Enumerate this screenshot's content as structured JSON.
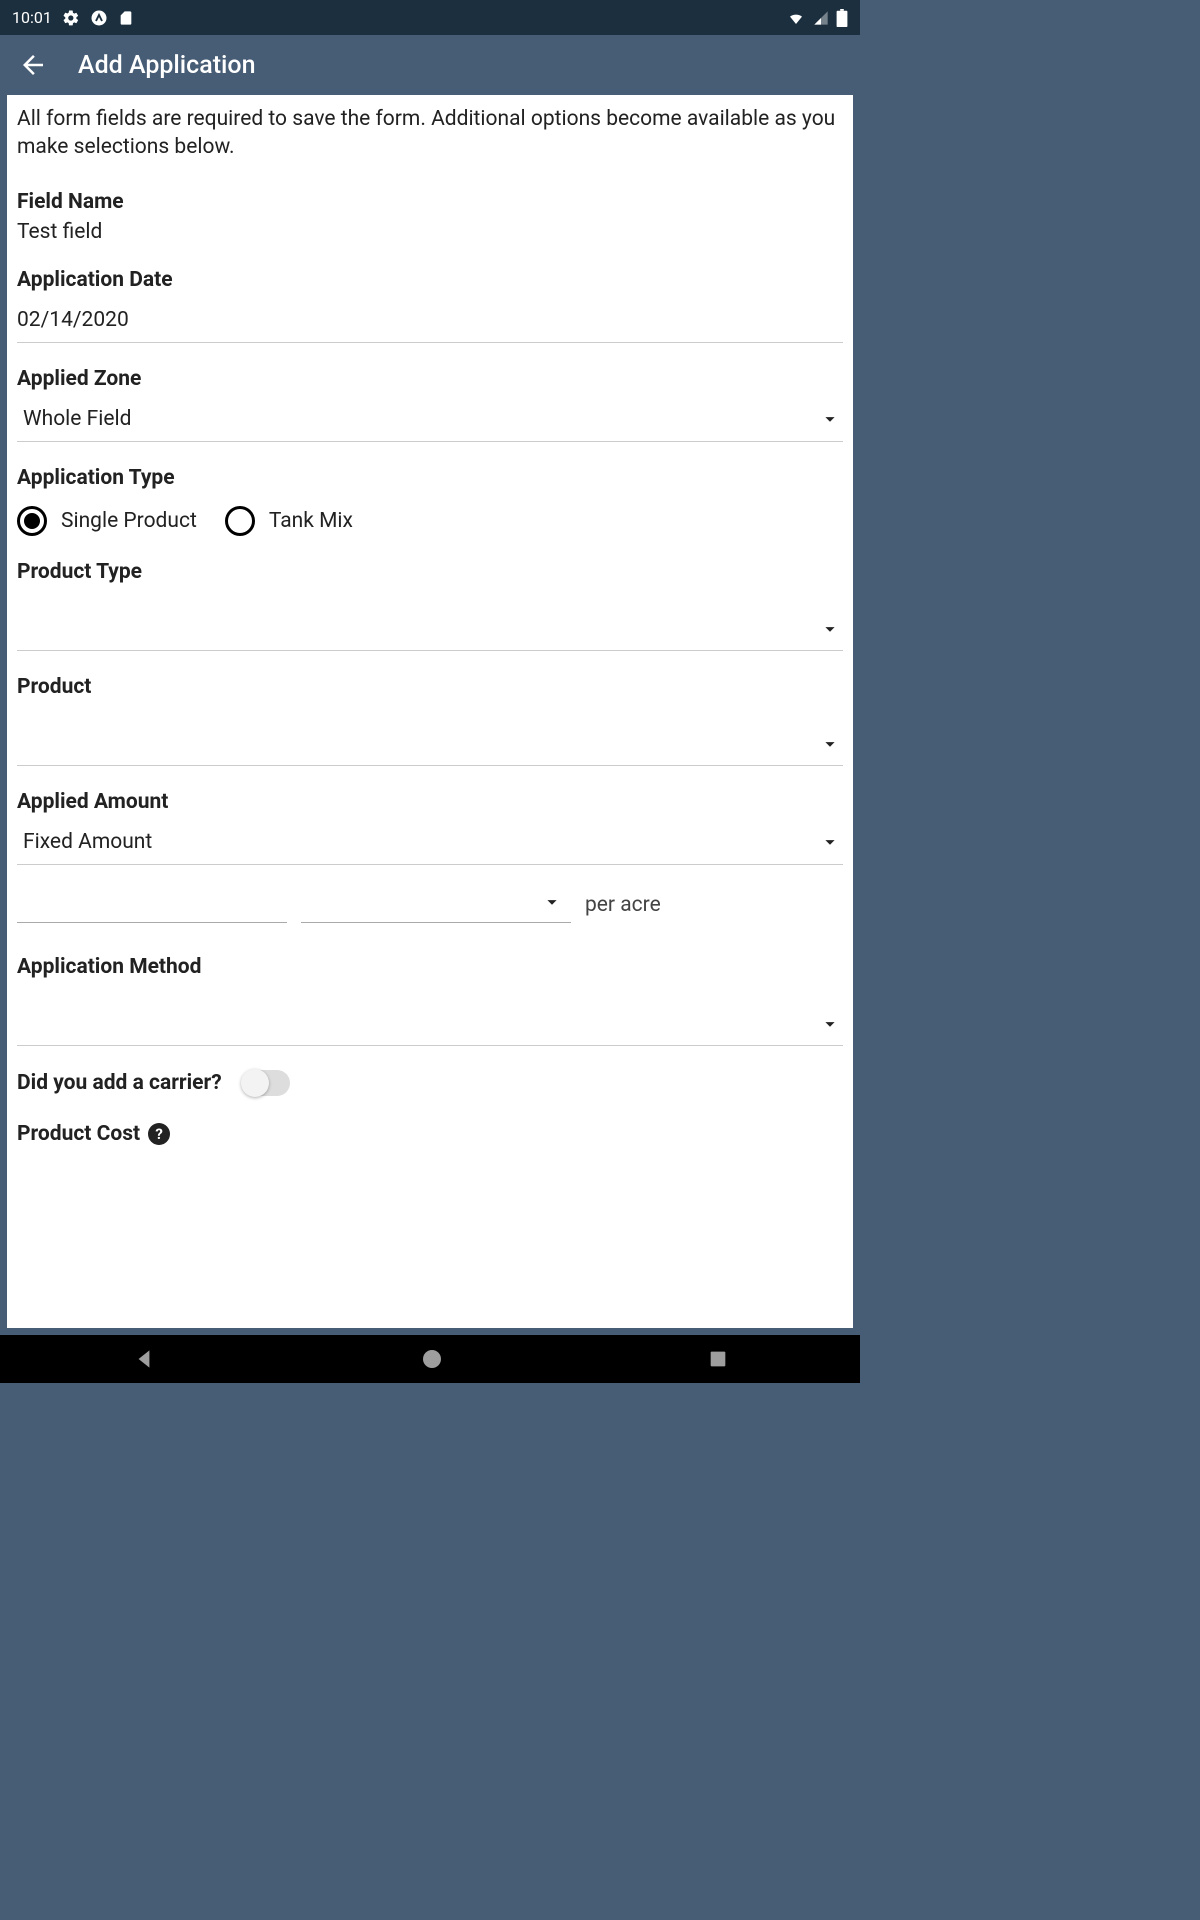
{
  "status": {
    "time": "10:01"
  },
  "header": {
    "title": "Add Application"
  },
  "form": {
    "instructions": "All form fields are required to save the form. Additional options become available as you make selections below.",
    "field_name_label": "Field Name",
    "field_name_value": "Test field",
    "application_date_label": "Application Date",
    "application_date_value": "02/14/2020",
    "applied_zone_label": "Applied Zone",
    "applied_zone_value": "Whole Field",
    "application_type_label": "Application Type",
    "application_type_options": {
      "single": "Single Product",
      "tank": "Tank Mix"
    },
    "product_type_label": "Product Type",
    "product_type_value": "",
    "product_label": "Product",
    "product_value": "",
    "applied_amount_label": "Applied Amount",
    "applied_amount_value": "Fixed Amount",
    "per_acre_label": "per acre",
    "application_method_label": "Application Method",
    "application_method_value": "",
    "carrier_label": "Did you add a carrier?",
    "product_cost_label": "Product Cost"
  }
}
